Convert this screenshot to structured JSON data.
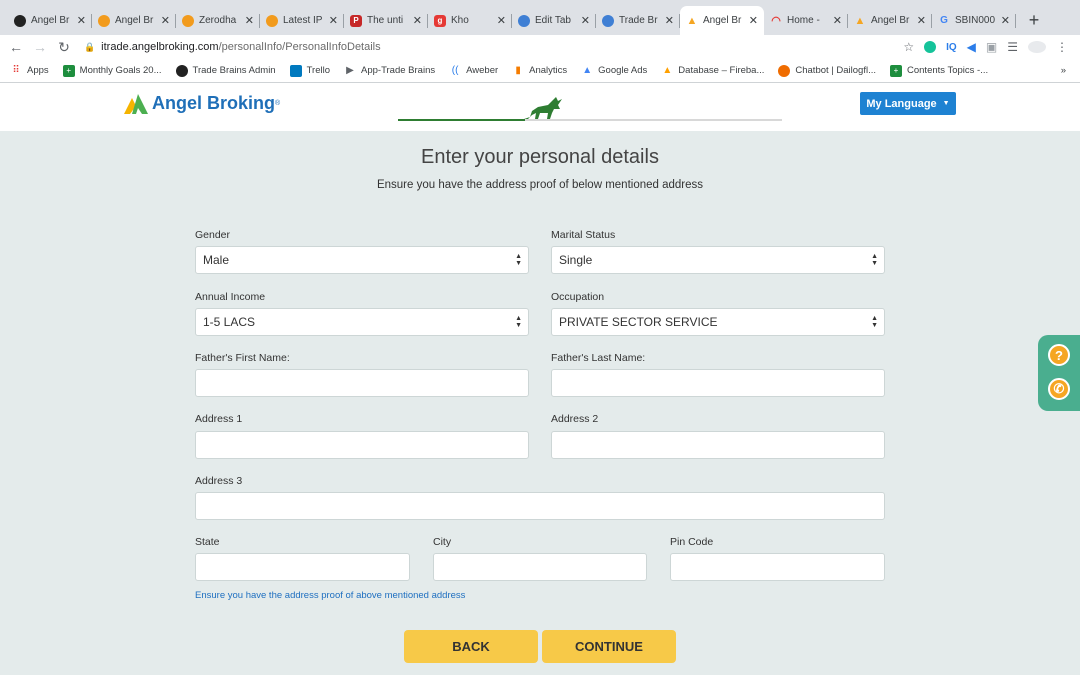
{
  "browser": {
    "tabs": [
      {
        "title": "Angel Br",
        "icon": "github-icon"
      },
      {
        "title": "Angel Br",
        "icon": "orange-circle-icon"
      },
      {
        "title": "Zerodha",
        "icon": "orange-circle-icon"
      },
      {
        "title": "Latest IP",
        "icon": "orange-circle-icon"
      },
      {
        "title": "The unti",
        "icon": "pinterest-icon"
      },
      {
        "title": "Kho",
        "icon": "g-icon"
      },
      {
        "title": "Edit Tab",
        "icon": "user-icon"
      },
      {
        "title": "Trade Br",
        "icon": "user-icon"
      },
      {
        "title": "Angel Br",
        "icon": "angel-icon"
      },
      {
        "title": "Home -",
        "icon": "wifi-icon"
      },
      {
        "title": "Angel Br",
        "icon": "angel-icon"
      },
      {
        "title": "SBIN000",
        "icon": "google-icon"
      }
    ],
    "url_host": "itrade.angelbroking.com",
    "url_path": "/personalInfo/PersonalInfoDetails",
    "bookmarks": [
      "Apps",
      "Monthly Goals 20...",
      "Trade Brains Admin",
      "Trello",
      "App-Trade Brains",
      "Aweber",
      "Analytics",
      "Google Ads",
      "Database – Fireba...",
      "Chatbot | Dailogfl...",
      "Contents Topics -..."
    ],
    "bookmarks_more": "»"
  },
  "header": {
    "brand": "Angel Broking",
    "language_button": "My Language",
    "progress": 0.33
  },
  "page": {
    "title": "Enter your personal details",
    "subtitle": "Ensure you have the address proof of below mentioned address"
  },
  "form": {
    "gender": {
      "label": "Gender",
      "value": "Male"
    },
    "marital_status": {
      "label": "Marital Status",
      "value": "Single"
    },
    "annual_income": {
      "label": "Annual Income",
      "value": "1-5 LACS"
    },
    "occupation": {
      "label": "Occupation",
      "value": "PRIVATE SECTOR SERVICE"
    },
    "father_first_name": {
      "label": "Father's First Name:",
      "value": ""
    },
    "father_last_name": {
      "label": "Father's Last Name:",
      "value": ""
    },
    "address1": {
      "label": "Address 1",
      "value": ""
    },
    "address2": {
      "label": "Address 2",
      "value": ""
    },
    "address3": {
      "label": "Address 3",
      "value": ""
    },
    "state": {
      "label": "State",
      "value": ""
    },
    "city": {
      "label": "City",
      "value": ""
    },
    "pin_code": {
      "label": "Pin Code",
      "value": ""
    },
    "note": "Ensure you have the address proof of above mentioned address"
  },
  "actions": {
    "back": "BACK",
    "continue": "CONTINUE"
  },
  "colors": {
    "brand_blue": "#1f6fb8",
    "button_yellow": "#f7c948",
    "help_green": "#4aae8f",
    "page_bg": "#e4ebeb"
  }
}
